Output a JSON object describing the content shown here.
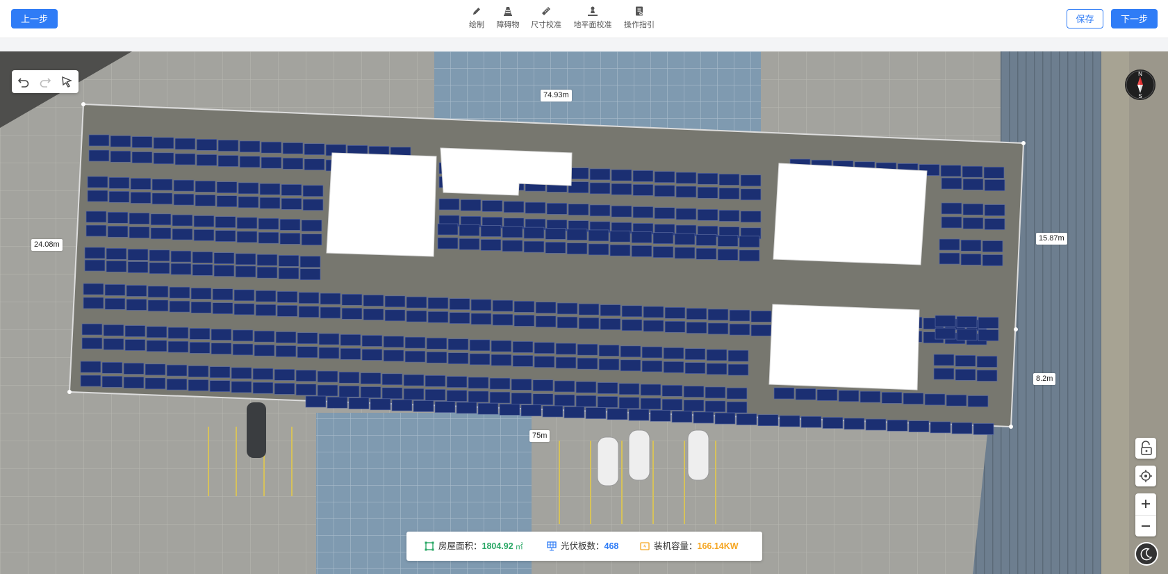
{
  "toolbar": {
    "prev_label": "上一步",
    "save_label": "保存",
    "next_label": "下一步",
    "tools": [
      {
        "label": "绘制",
        "icon": "pencil-icon"
      },
      {
        "label": "障碍物",
        "icon": "obstacle-icon"
      },
      {
        "label": "尺寸校准",
        "icon": "ruler-icon"
      },
      {
        "label": "地平面校准",
        "icon": "ground-plane-icon"
      },
      {
        "label": "操作指引",
        "icon": "guide-icon"
      }
    ]
  },
  "map": {
    "dimensions": {
      "top": "74.93m",
      "left": "24.08m",
      "right_upper": "15.87m",
      "right_lower": "8.2m",
      "bottom": "75m"
    },
    "compass": {
      "north": "N",
      "south": "S"
    }
  },
  "stats": {
    "area_label": "房屋面积：",
    "area_value": "1804.92",
    "area_unit": "㎡",
    "panel_label": "光伏板数：",
    "panel_value": "468",
    "capacity_label": "装机容量：",
    "capacity_value": "166.14KW"
  },
  "colors": {
    "primary": "#2f7cf6",
    "panel": "#1b2f72",
    "area": "#2aa866",
    "capacity": "#f5a623"
  }
}
